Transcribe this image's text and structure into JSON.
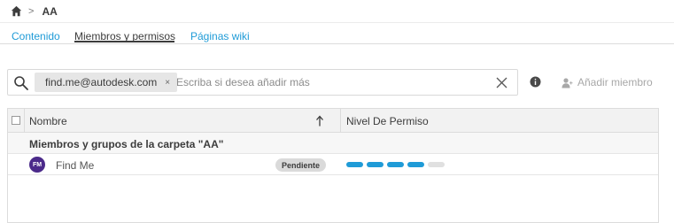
{
  "breadcrumb": {
    "home_icon": "home-icon",
    "separator": ">",
    "current": "AA"
  },
  "tabs": [
    {
      "label": "Contenido",
      "active": false
    },
    {
      "label": "Miembros y permisos",
      "active": true
    },
    {
      "label": "Páginas wiki",
      "active": false
    }
  ],
  "search": {
    "chip_label": "find.me@autodesk.com",
    "chip_remove": "×",
    "placeholder": "Escriba si desea añadir más",
    "value": ""
  },
  "toolbar": {
    "add_member_label": "Añadir miembro"
  },
  "table": {
    "columns": {
      "name": "Nombre",
      "permission": "Nivel De Permiso"
    },
    "group_label": "Miembros y grupos de la carpeta \"AA\"",
    "members": [
      {
        "initials": "FM",
        "name": "Find Me",
        "status": "Pendiente",
        "permission_level": 4,
        "permission_max": 5
      }
    ]
  },
  "colors": {
    "accent": "#1f9bd7",
    "avatar": "#4b2a8a",
    "disabled": "#a8a8a8"
  }
}
